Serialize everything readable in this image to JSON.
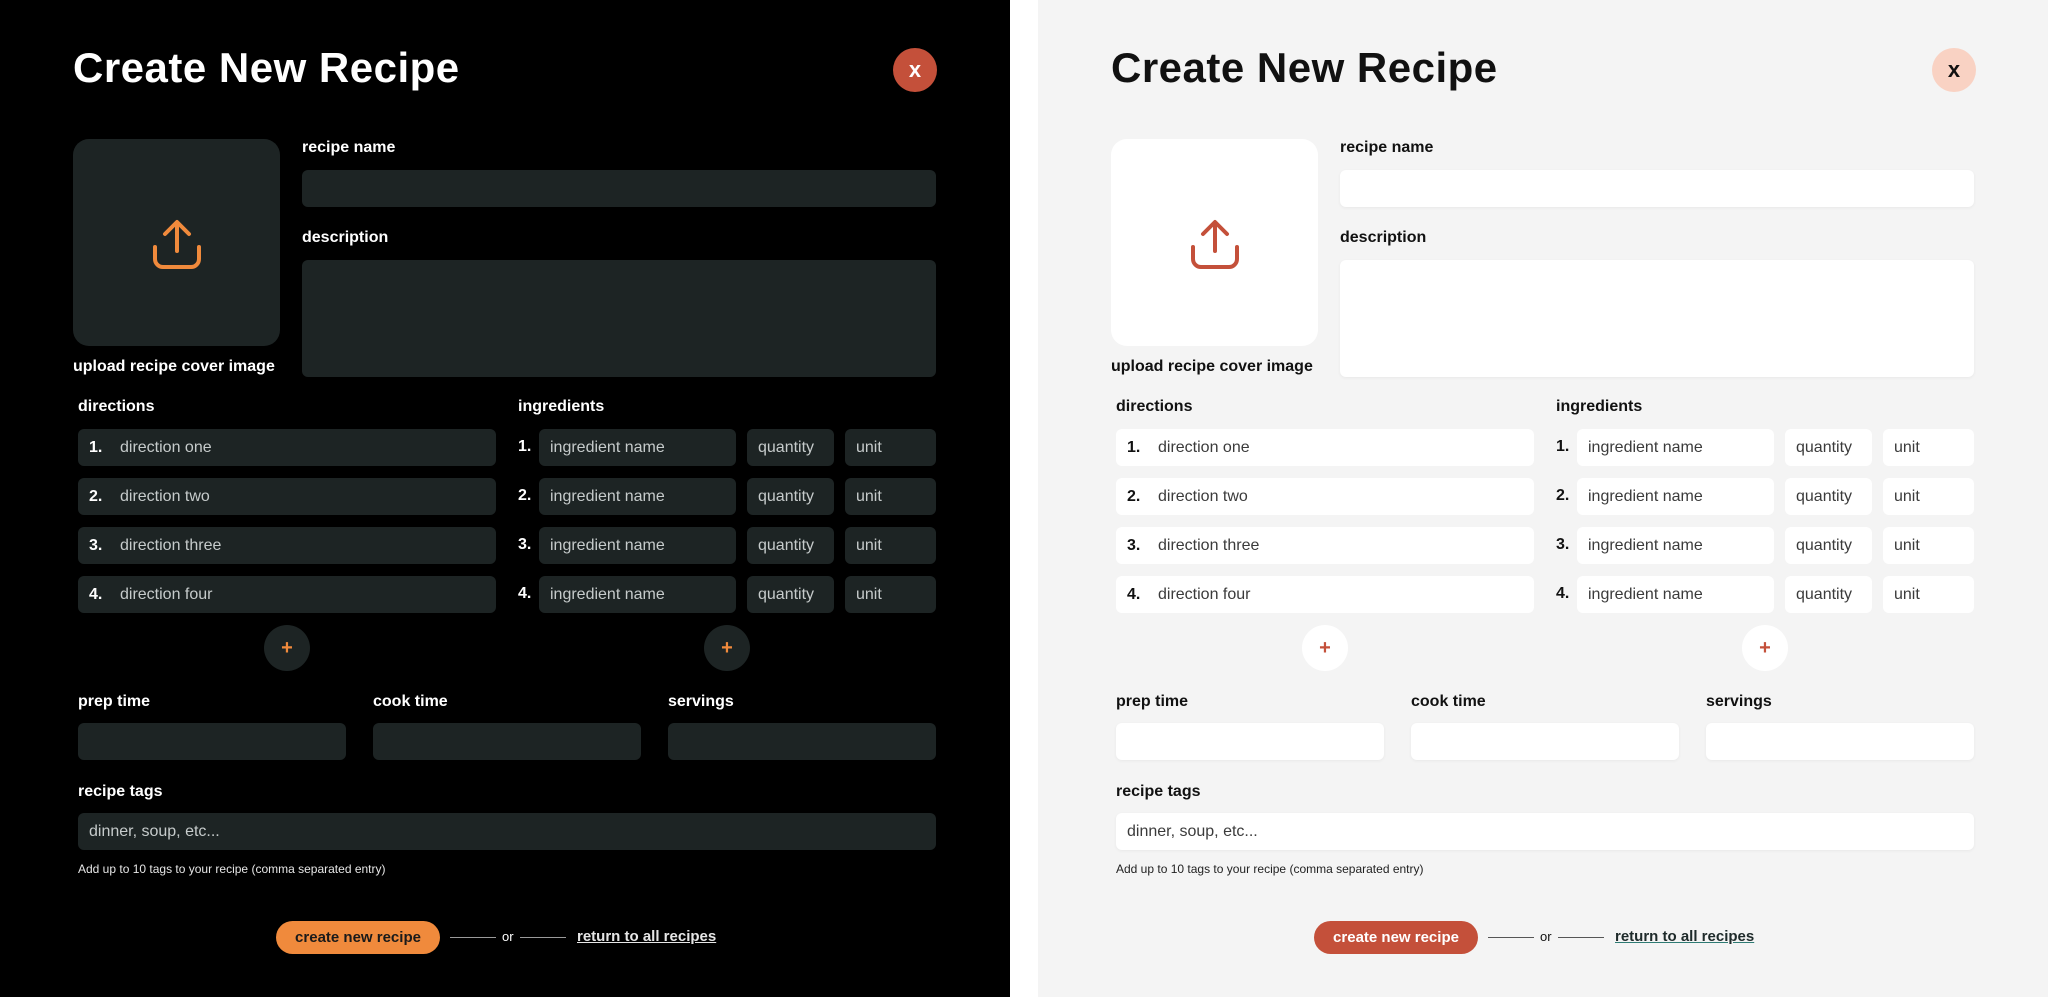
{
  "title": "Create New Recipe",
  "close_label": "x",
  "upload_label": "upload recipe cover image",
  "recipe_name_label": "recipe name",
  "description_label": "description",
  "directions_label": "directions",
  "ingredients_label": "ingredients",
  "directions": [
    {
      "num": "1.",
      "placeholder": "direction one"
    },
    {
      "num": "2.",
      "placeholder": "direction two"
    },
    {
      "num": "3.",
      "placeholder": "direction three"
    },
    {
      "num": "4.",
      "placeholder": "direction four"
    }
  ],
  "ingredients": [
    {
      "num": "1.",
      "name": "ingredient name",
      "quantity": "quantity",
      "unit": "unit"
    },
    {
      "num": "2.",
      "name": "ingredient name",
      "quantity": "quantity",
      "unit": "unit"
    },
    {
      "num": "3.",
      "name": "ingredient name",
      "quantity": "quantity",
      "unit": "unit"
    },
    {
      "num": "4.",
      "name": "ingredient name",
      "quantity": "quantity",
      "unit": "unit"
    }
  ],
  "add_label": "+",
  "prep_time_label": "prep time",
  "cook_time_label": "cook time",
  "servings_label": "servings",
  "tags_label": "recipe tags",
  "tags_placeholder": "dinner, soup, etc...",
  "tags_hint": "Add up to 10 tags to your recipe (comma separated entry)",
  "create_button": "create new recipe",
  "or_text": "or",
  "return_link": "return to all recipes",
  "colors": {
    "dark_accent": "#f08a3c",
    "light_accent": "#c4503a",
    "close_dark": "#c4503a",
    "close_light": "#f9d2c3",
    "dark_field": "#1d2424"
  },
  "icons": {
    "upload": "upload-icon",
    "close": "close-icon",
    "add": "plus-icon"
  }
}
